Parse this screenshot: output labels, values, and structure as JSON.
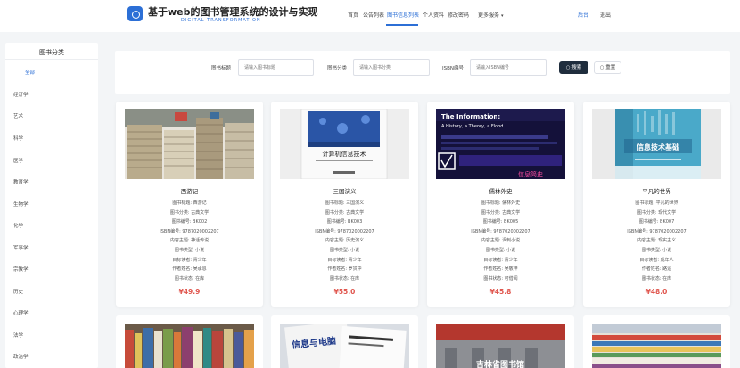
{
  "header": {
    "site_title": "基于web的图书管理系统的设计与实现",
    "site_subtitle": "DIGITAL TRANSFORMATION",
    "nav": [
      "首页",
      "公告列表",
      "图书信息列表",
      "个人资料",
      "修改密码",
      "更多服务"
    ],
    "active_nav": "图书信息列表",
    "right_nav": [
      "后台",
      "退出"
    ],
    "accent_color": "#2c6fd6"
  },
  "sidebar": {
    "title": "图书分类",
    "categories": [
      "全部",
      "经济学",
      "艺术",
      "科学",
      "医学",
      "教育学",
      "生物学",
      "化学",
      "军事学",
      "宗教学",
      "历史",
      "心理学",
      "法学",
      "政治学"
    ]
  },
  "search": {
    "fields": [
      {
        "label": "图书标题",
        "placeholder": "请输入图书标题"
      },
      {
        "label": "图书分类",
        "placeholder": "请输入图书分类"
      },
      {
        "label": "ISBN编号",
        "placeholder": "请输入ISBN编号"
      }
    ],
    "search_button": "搜索",
    "reset_button": "重置"
  },
  "books": [
    {
      "title": "西游记",
      "lines": [
        "图书标题: 西游记",
        "图书分类: 古典文学",
        "图书编号: BK002",
        "ISBN编号: 9787020002207",
        "内容主题: 神话传说",
        "图书类型: 小说",
        "目标读者: 青少年",
        "作者姓名: 吴承恩",
        "图书状态: 在库"
      ],
      "price": "¥49.9"
    },
    {
      "title": "三国演义",
      "lines": [
        "图书标题: 三国演义",
        "图书分类: 古典文学",
        "图书编号: BK003",
        "ISBN编号: 9787020002207",
        "内容主题: 历史演义",
        "图书类型: 小说",
        "目标读者: 青少年",
        "作者姓名: 罗贯中",
        "图书状态: 在库"
      ],
      "price": "¥55.0"
    },
    {
      "title": "儒林外史",
      "lines": [
        "图书标题: 儒林外史",
        "图书分类: 古典文学",
        "图书编号: BK005",
        "ISBN编号: 9787020002207",
        "内容主题: 讽刺小说",
        "图书类型: 小说",
        "目标读者: 青少年",
        "作者姓名: 吴敬梓",
        "图书状态: 可借阅"
      ],
      "price": "¥45.8"
    },
    {
      "title": "平凡的世界",
      "lines": [
        "图书标题: 平凡的世界",
        "图书分类: 现代文学",
        "图书编号: BK007",
        "ISBN编号: 9787020002207",
        "内容主题: 现实主义",
        "图书类型: 小说",
        "目标读者: 成年人",
        "作者姓名: 路遥",
        "图书状态: 在库"
      ],
      "price": "¥48.0"
    }
  ],
  "cover_texts": {
    "book2": "计算机信息技术",
    "book3_top": "The Information:",
    "book3_sub": "A History, a Theory, a Flood",
    "book3_cn": "信息简史",
    "book4": "信息技术基础",
    "row2_b2": "信息与电脑",
    "row2_b3": "吉林省图书馆"
  }
}
